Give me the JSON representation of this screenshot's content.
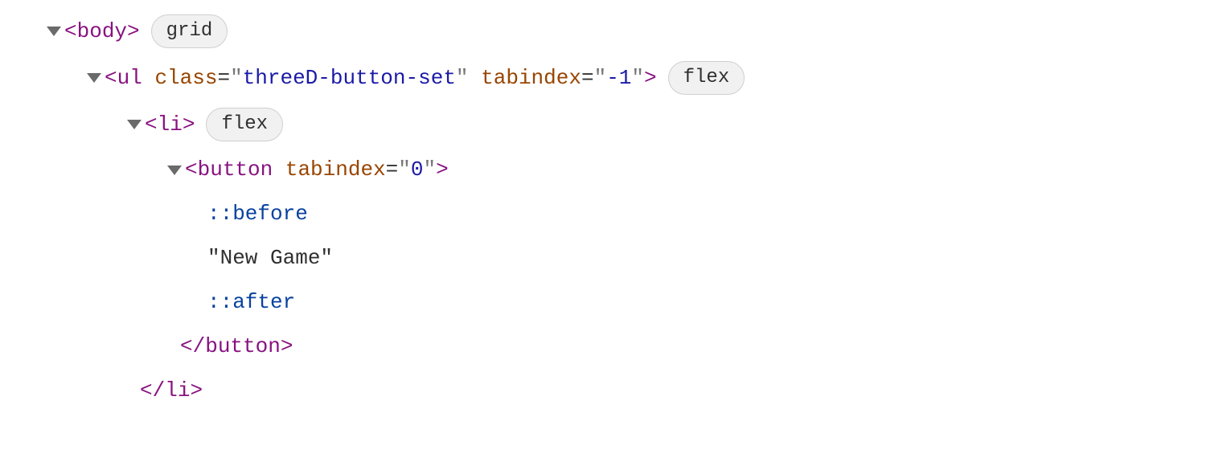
{
  "tree": {
    "row0": {
      "tag": "body",
      "badge": "grid"
    },
    "row1": {
      "tag": "ul",
      "attrClass": {
        "name": "class",
        "value": "threeD-button-set"
      },
      "attrTabindex": {
        "name": "tabindex",
        "value": "-1"
      },
      "badge": "flex"
    },
    "row2": {
      "tag": "li",
      "badge": "flex"
    },
    "row3": {
      "tag": "button",
      "attrTabindex": {
        "name": "tabindex",
        "value": "0"
      }
    },
    "row4": {
      "pseudo": "::before"
    },
    "row5": {
      "text": "\"New Game\""
    },
    "row6": {
      "pseudo": "::after"
    },
    "row7": {
      "closeTag": "button"
    },
    "row8": {
      "closeTag": "li"
    }
  }
}
